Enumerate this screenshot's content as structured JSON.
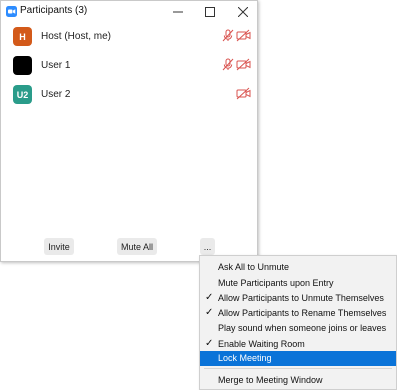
{
  "window": {
    "title": "Participants (3)",
    "accent": "#2d8cff"
  },
  "participants": [
    {
      "initials": "H",
      "name": "Host (Host, me)",
      "avatar_color": "#d35a1a",
      "mic_muted": true,
      "video_off": true
    },
    {
      "initials": "",
      "name": "User 1",
      "avatar_color": "#000000",
      "mic_muted": true,
      "video_off": true
    },
    {
      "initials": "U2",
      "name": "User 2",
      "avatar_color": "#2a9c8a",
      "mic_muted": false,
      "video_off": true
    }
  ],
  "footer": {
    "invite_label": "Invite",
    "mute_all_label": "Mute All",
    "more_label": "..."
  },
  "menu": {
    "items": [
      {
        "label": "Ask All to Unmute",
        "checked": false
      },
      {
        "label": "Mute Participants upon Entry",
        "checked": false
      },
      {
        "label": "Allow Participants to Unmute Themselves",
        "checked": true
      },
      {
        "label": "Allow Participants to Rename Themselves",
        "checked": true
      },
      {
        "label": "Play sound when someone joins or leaves",
        "checked": false
      },
      {
        "label": "Enable Waiting Room",
        "checked": true
      },
      {
        "label": "Lock Meeting",
        "checked": false,
        "highlighted": true
      },
      {
        "label": "Merge to Meeting Window",
        "checked": false
      }
    ],
    "check_glyph": "✓",
    "highlight_color": "#0a73d8"
  },
  "icons": {
    "muted_color": "#d9534f"
  }
}
